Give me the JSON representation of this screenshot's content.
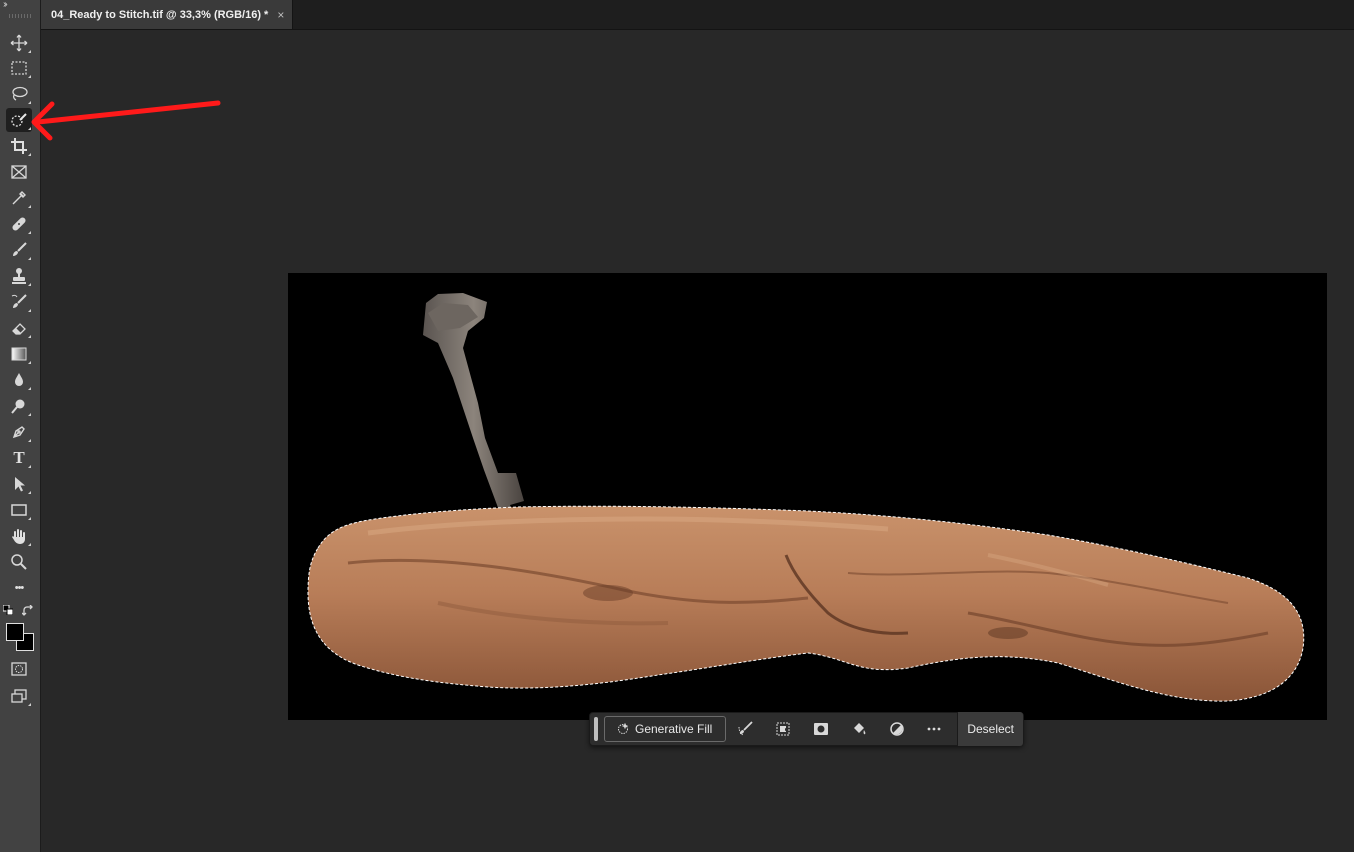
{
  "document": {
    "tab_title": "04_Ready to Stitch.tif @ 33,3% (RGB/16) *",
    "close_glyph": "×"
  },
  "toolbar": {
    "collapse_glyph": "››",
    "tools": [
      {
        "name": "move-tool",
        "icon": "move-icon"
      },
      {
        "name": "rectangular-marquee-tool",
        "icon": "marquee-icon"
      },
      {
        "name": "lasso-tool",
        "icon": "lasso-icon"
      },
      {
        "name": "quick-selection-tool",
        "icon": "quick-selection-icon",
        "active": true
      },
      {
        "name": "crop-tool",
        "icon": "crop-icon"
      },
      {
        "name": "frame-tool",
        "icon": "frame-icon"
      },
      {
        "name": "eyedropper-tool",
        "icon": "eyedropper-icon"
      },
      {
        "name": "spot-healing-brush-tool",
        "icon": "bandage-icon"
      },
      {
        "name": "brush-tool",
        "icon": "brush-icon"
      },
      {
        "name": "clone-stamp-tool",
        "icon": "stamp-icon"
      },
      {
        "name": "history-brush-tool",
        "icon": "history-brush-icon"
      },
      {
        "name": "eraser-tool",
        "icon": "eraser-icon"
      },
      {
        "name": "gradient-tool",
        "icon": "gradient-icon"
      },
      {
        "name": "blur-tool",
        "icon": "drop-icon"
      },
      {
        "name": "dodge-tool",
        "icon": "dodge-icon"
      },
      {
        "name": "pen-tool",
        "icon": "pen-icon"
      },
      {
        "name": "type-tool",
        "icon": "type-icon",
        "label": "T"
      },
      {
        "name": "path-selection-tool",
        "icon": "arrow-cursor-icon"
      },
      {
        "name": "rectangle-tool",
        "icon": "rectangle-icon"
      },
      {
        "name": "hand-tool",
        "icon": "hand-icon"
      },
      {
        "name": "zoom-tool",
        "icon": "magnifier-icon"
      },
      {
        "name": "edit-toolbar",
        "icon": "more-icon",
        "label": "•••"
      },
      {
        "name": "quick-mask",
        "icon": "quick-mask-icon"
      },
      {
        "name": "screen-mode",
        "icon": "screen-mode-icon"
      }
    ],
    "foreground_color": "#000000",
    "background_color": "#000000"
  },
  "taskbar": {
    "generative_fill_label": "Generative Fill",
    "icons": [
      "select-subject-icon",
      "modify-selection-icon",
      "create-mask-icon",
      "fill-selection-icon",
      "adjustment-layer-icon",
      "more-options-icon"
    ],
    "deselect_label": "Deselect"
  },
  "colors": {
    "app_background": "#282828",
    "toolbar_background": "#424242",
    "canvas_background": "#000000",
    "annotation_arrow": "#ff1a1a",
    "rock": "#b57a57"
  }
}
